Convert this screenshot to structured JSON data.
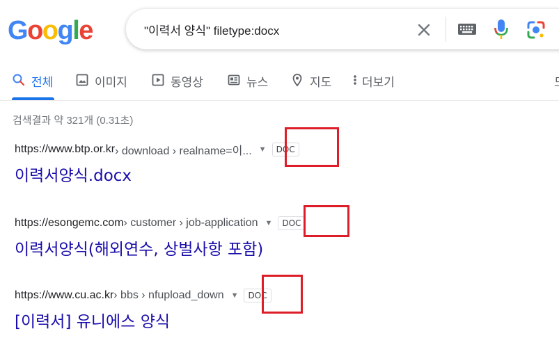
{
  "logo": {
    "letters": [
      "G",
      "o",
      "o",
      "g",
      "l",
      "e"
    ]
  },
  "search": {
    "query": "\"이력서 양식\" filetype:docx"
  },
  "tabs": [
    {
      "label": "전체",
      "icon": "search-icon"
    },
    {
      "label": "이미지",
      "icon": "image-icon"
    },
    {
      "label": "동영상",
      "icon": "video-icon"
    },
    {
      "label": "뉴스",
      "icon": "news-icon"
    },
    {
      "label": "지도",
      "icon": "map-pin-icon"
    },
    {
      "label": "더보기",
      "icon": "more-vert-icon"
    }
  ],
  "tab_edge": "도",
  "stats": "검색결과 약 321개 (0.31초)",
  "results": [
    {
      "domain": "https://www.btp.or.kr",
      "path": " › download › realname=이...",
      "badge": "DOC",
      "title": "이력서양식.docx"
    },
    {
      "domain": "https://esongemc.com",
      "path": " › customer › job-application",
      "badge": "DOC",
      "title": "이력서양식(해외연수, 상벌사항 포함)"
    },
    {
      "domain": "https://www.cu.ac.kr",
      "path": " › bbs › nfupload_down",
      "badge": "DOC",
      "title": "[이력서] 유니에스 양식"
    }
  ],
  "colors": {
    "logo": [
      "#4285f4",
      "#ea4335",
      "#fbbc05",
      "#4285f4",
      "#34a853",
      "#ea4335"
    ],
    "link": "#1a0dab",
    "accent": "#1a73e8",
    "highlight": "#dd1e28"
  }
}
